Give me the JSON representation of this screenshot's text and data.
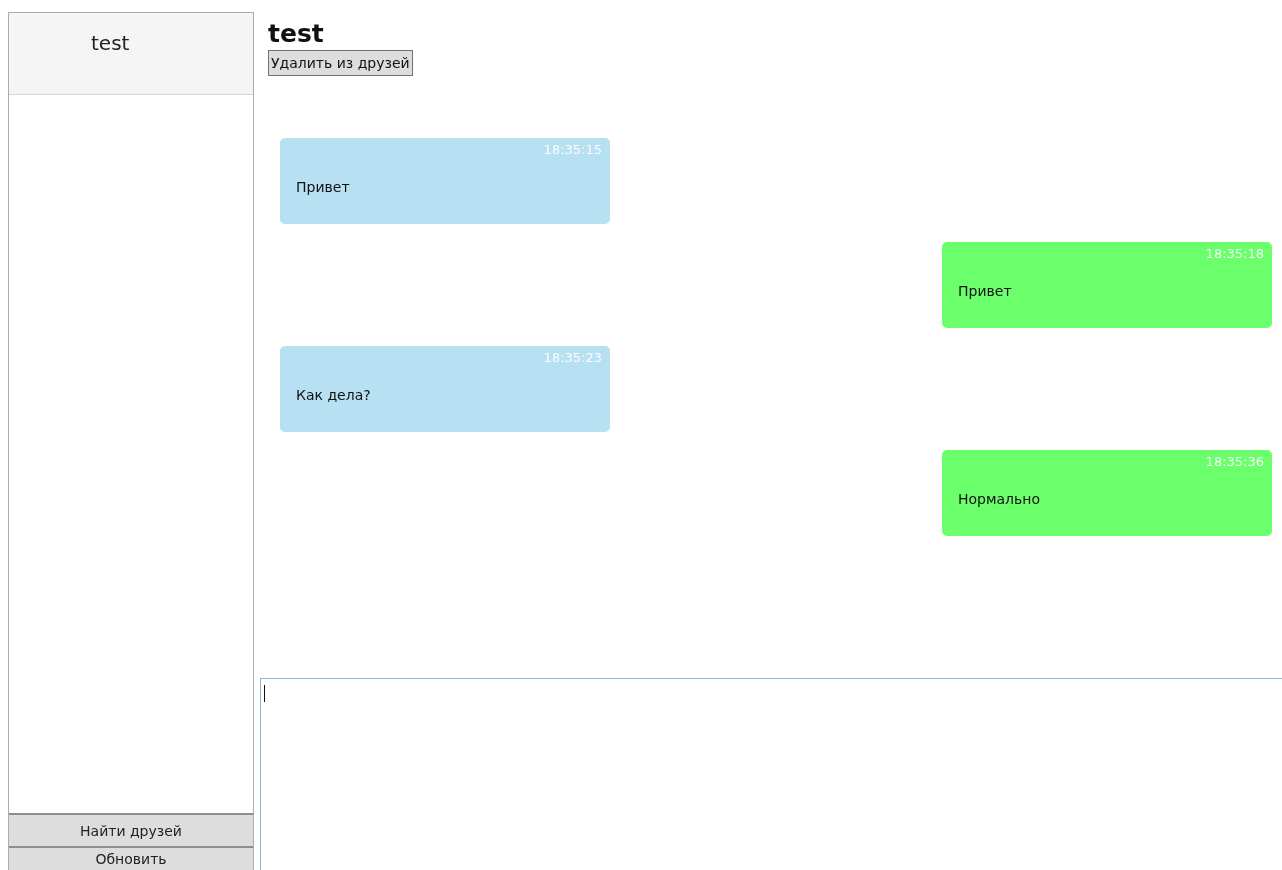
{
  "sidebar": {
    "friends": [
      {
        "name": "test"
      }
    ],
    "buttons": [
      "Найти друзей",
      "Обновить"
    ]
  },
  "chat": {
    "title": "test",
    "remove_button": "Удалить из друзей",
    "messages": [
      {
        "kind": "incoming",
        "time": "18:35:15",
        "text": "Привет"
      },
      {
        "kind": "outgoing",
        "time": "18:35:18",
        "text": "Привет"
      },
      {
        "kind": "incoming",
        "time": "18:35:23",
        "text": "Как дела?"
      },
      {
        "kind": "outgoing",
        "time": "18:35:36",
        "text": "Нормально"
      }
    ]
  }
}
